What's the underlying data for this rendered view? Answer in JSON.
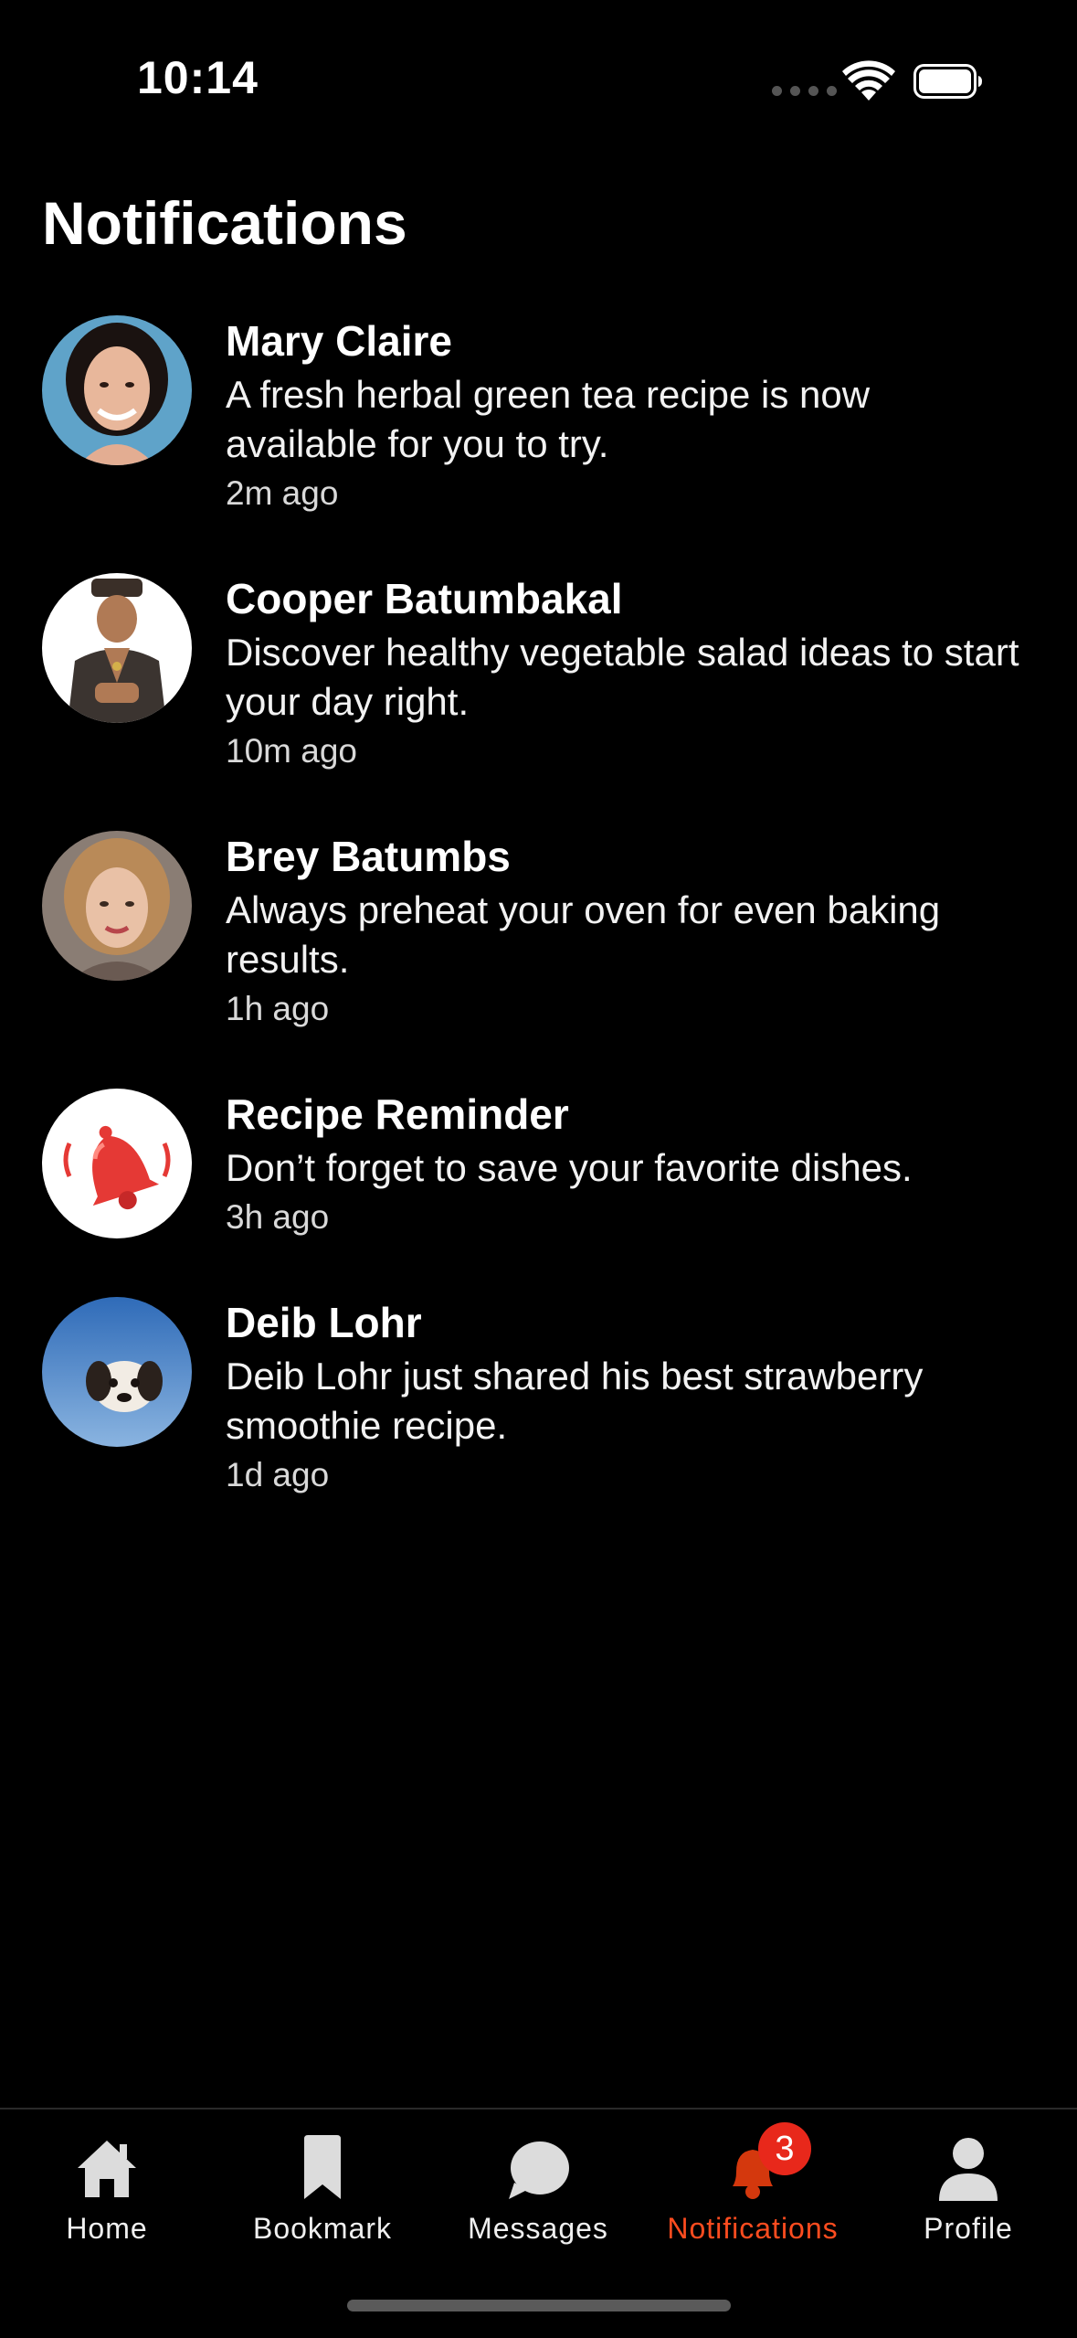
{
  "status_bar": {
    "time": "10:14"
  },
  "page": {
    "title": "Notifications"
  },
  "notifications": [
    {
      "sender": "Mary Claire",
      "message": "A fresh herbal green tea recipe is now available for you to try.",
      "time_ago": "2m ago",
      "avatar": "woman-portrait-avatar"
    },
    {
      "sender": "Cooper Batumbakal",
      "message": "Discover healthy vegetable salad ideas to start your day right.",
      "time_ago": "10m ago",
      "avatar": "man-portrait-avatar"
    },
    {
      "sender": "Brey Batumbs",
      "message": "Always preheat your oven for even baking results.",
      "time_ago": "1h ago",
      "avatar": "woman-portrait-avatar"
    },
    {
      "sender": "Recipe Reminder",
      "message": "Don’t forget to save your favorite dishes.",
      "time_ago": "3h ago",
      "avatar": "red-bell-icon"
    },
    {
      "sender": "Deib Lohr",
      "message": "Deib Lohr just shared his best strawberry smoothie recipe.",
      "time_ago": "1d ago",
      "avatar": "puppy-avatar"
    }
  ],
  "tab_bar": {
    "tabs": [
      {
        "label": "Home",
        "icon": "home-icon",
        "active": false
      },
      {
        "label": "Bookmark",
        "icon": "bookmark-icon",
        "active": false
      },
      {
        "label": "Messages",
        "icon": "chat-bubble-icon",
        "active": false
      },
      {
        "label": "Notifications",
        "icon": "bell-icon",
        "active": true,
        "badge": "3"
      },
      {
        "label": "Profile",
        "icon": "person-icon",
        "active": false
      }
    ],
    "active_color": "#ff4c1f",
    "badge_color": "#e8281b"
  }
}
